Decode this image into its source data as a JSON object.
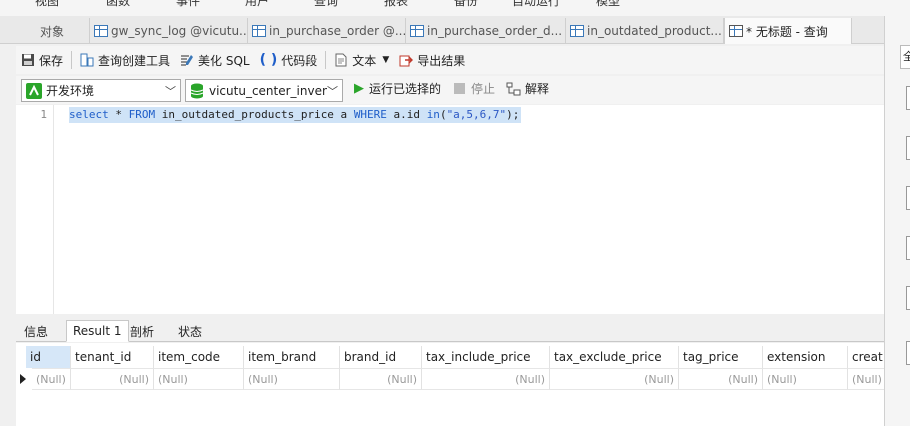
{
  "menu": [
    "视图",
    "函数",
    "事件",
    "用户",
    "查询",
    "报表",
    "备份",
    "自动运行",
    "模型"
  ],
  "tabs": [
    {
      "label": "对象",
      "active": false,
      "icon": false
    },
    {
      "label": "gw_sync_log @vicutu...",
      "active": false,
      "icon": true
    },
    {
      "label": "in_purchase_order @...",
      "active": false,
      "icon": true
    },
    {
      "label": "in_purchase_order_d...",
      "active": false,
      "icon": true
    },
    {
      "label": "in_outdated_product...",
      "active": false,
      "icon": true
    },
    {
      "label": "* 无标题 - 查询",
      "active": true,
      "icon": true
    }
  ],
  "toolbar": {
    "save": "保存",
    "query_builder": "查询创建工具",
    "beautify": "美化 SQL",
    "snippet": "代码段",
    "text": "文本",
    "export": "导出结果"
  },
  "connection": {
    "value": "开发环境"
  },
  "database": {
    "value": "vicutu_center_invento"
  },
  "run_selected": "运行已选择的",
  "stop": "停止",
  "explain": "解释",
  "editor": {
    "line_number": "1",
    "tokens": [
      {
        "t": "select",
        "c": "kw"
      },
      {
        "t": " * ",
        "c": "id"
      },
      {
        "t": "FROM",
        "c": "kw"
      },
      {
        "t": " in_outdated_products_price a ",
        "c": "id"
      },
      {
        "t": "WHERE",
        "c": "kw"
      },
      {
        "t": " a.id ",
        "c": "id"
      },
      {
        "t": "in",
        "c": "kw"
      },
      {
        "t": "(",
        "c": "id"
      },
      {
        "t": "\"a,5,6,7\"",
        "c": "str"
      },
      {
        "t": ");",
        "c": "id"
      }
    ]
  },
  "result_tabs": [
    "信息",
    "Result 1",
    "剖析",
    "状态"
  ],
  "grid": {
    "columns": [
      "id",
      "tenant_id",
      "item_code",
      "item_brand",
      "brand_id",
      "tax_include_price",
      "tax_exclude_price",
      "tag_price",
      "extension",
      "creat"
    ],
    "row": [
      "(Null)",
      "(Null)",
      "(Null)",
      "(Null)",
      "(Null)",
      "(Null)",
      "(Null)",
      "(Null)",
      "(Null)",
      "(Null)"
    ]
  },
  "right_panel": {
    "label": "全"
  },
  "colors": {
    "accent": "#1f5ec9",
    "selection": "#cfe3f7",
    "run": "#2aa52a"
  }
}
